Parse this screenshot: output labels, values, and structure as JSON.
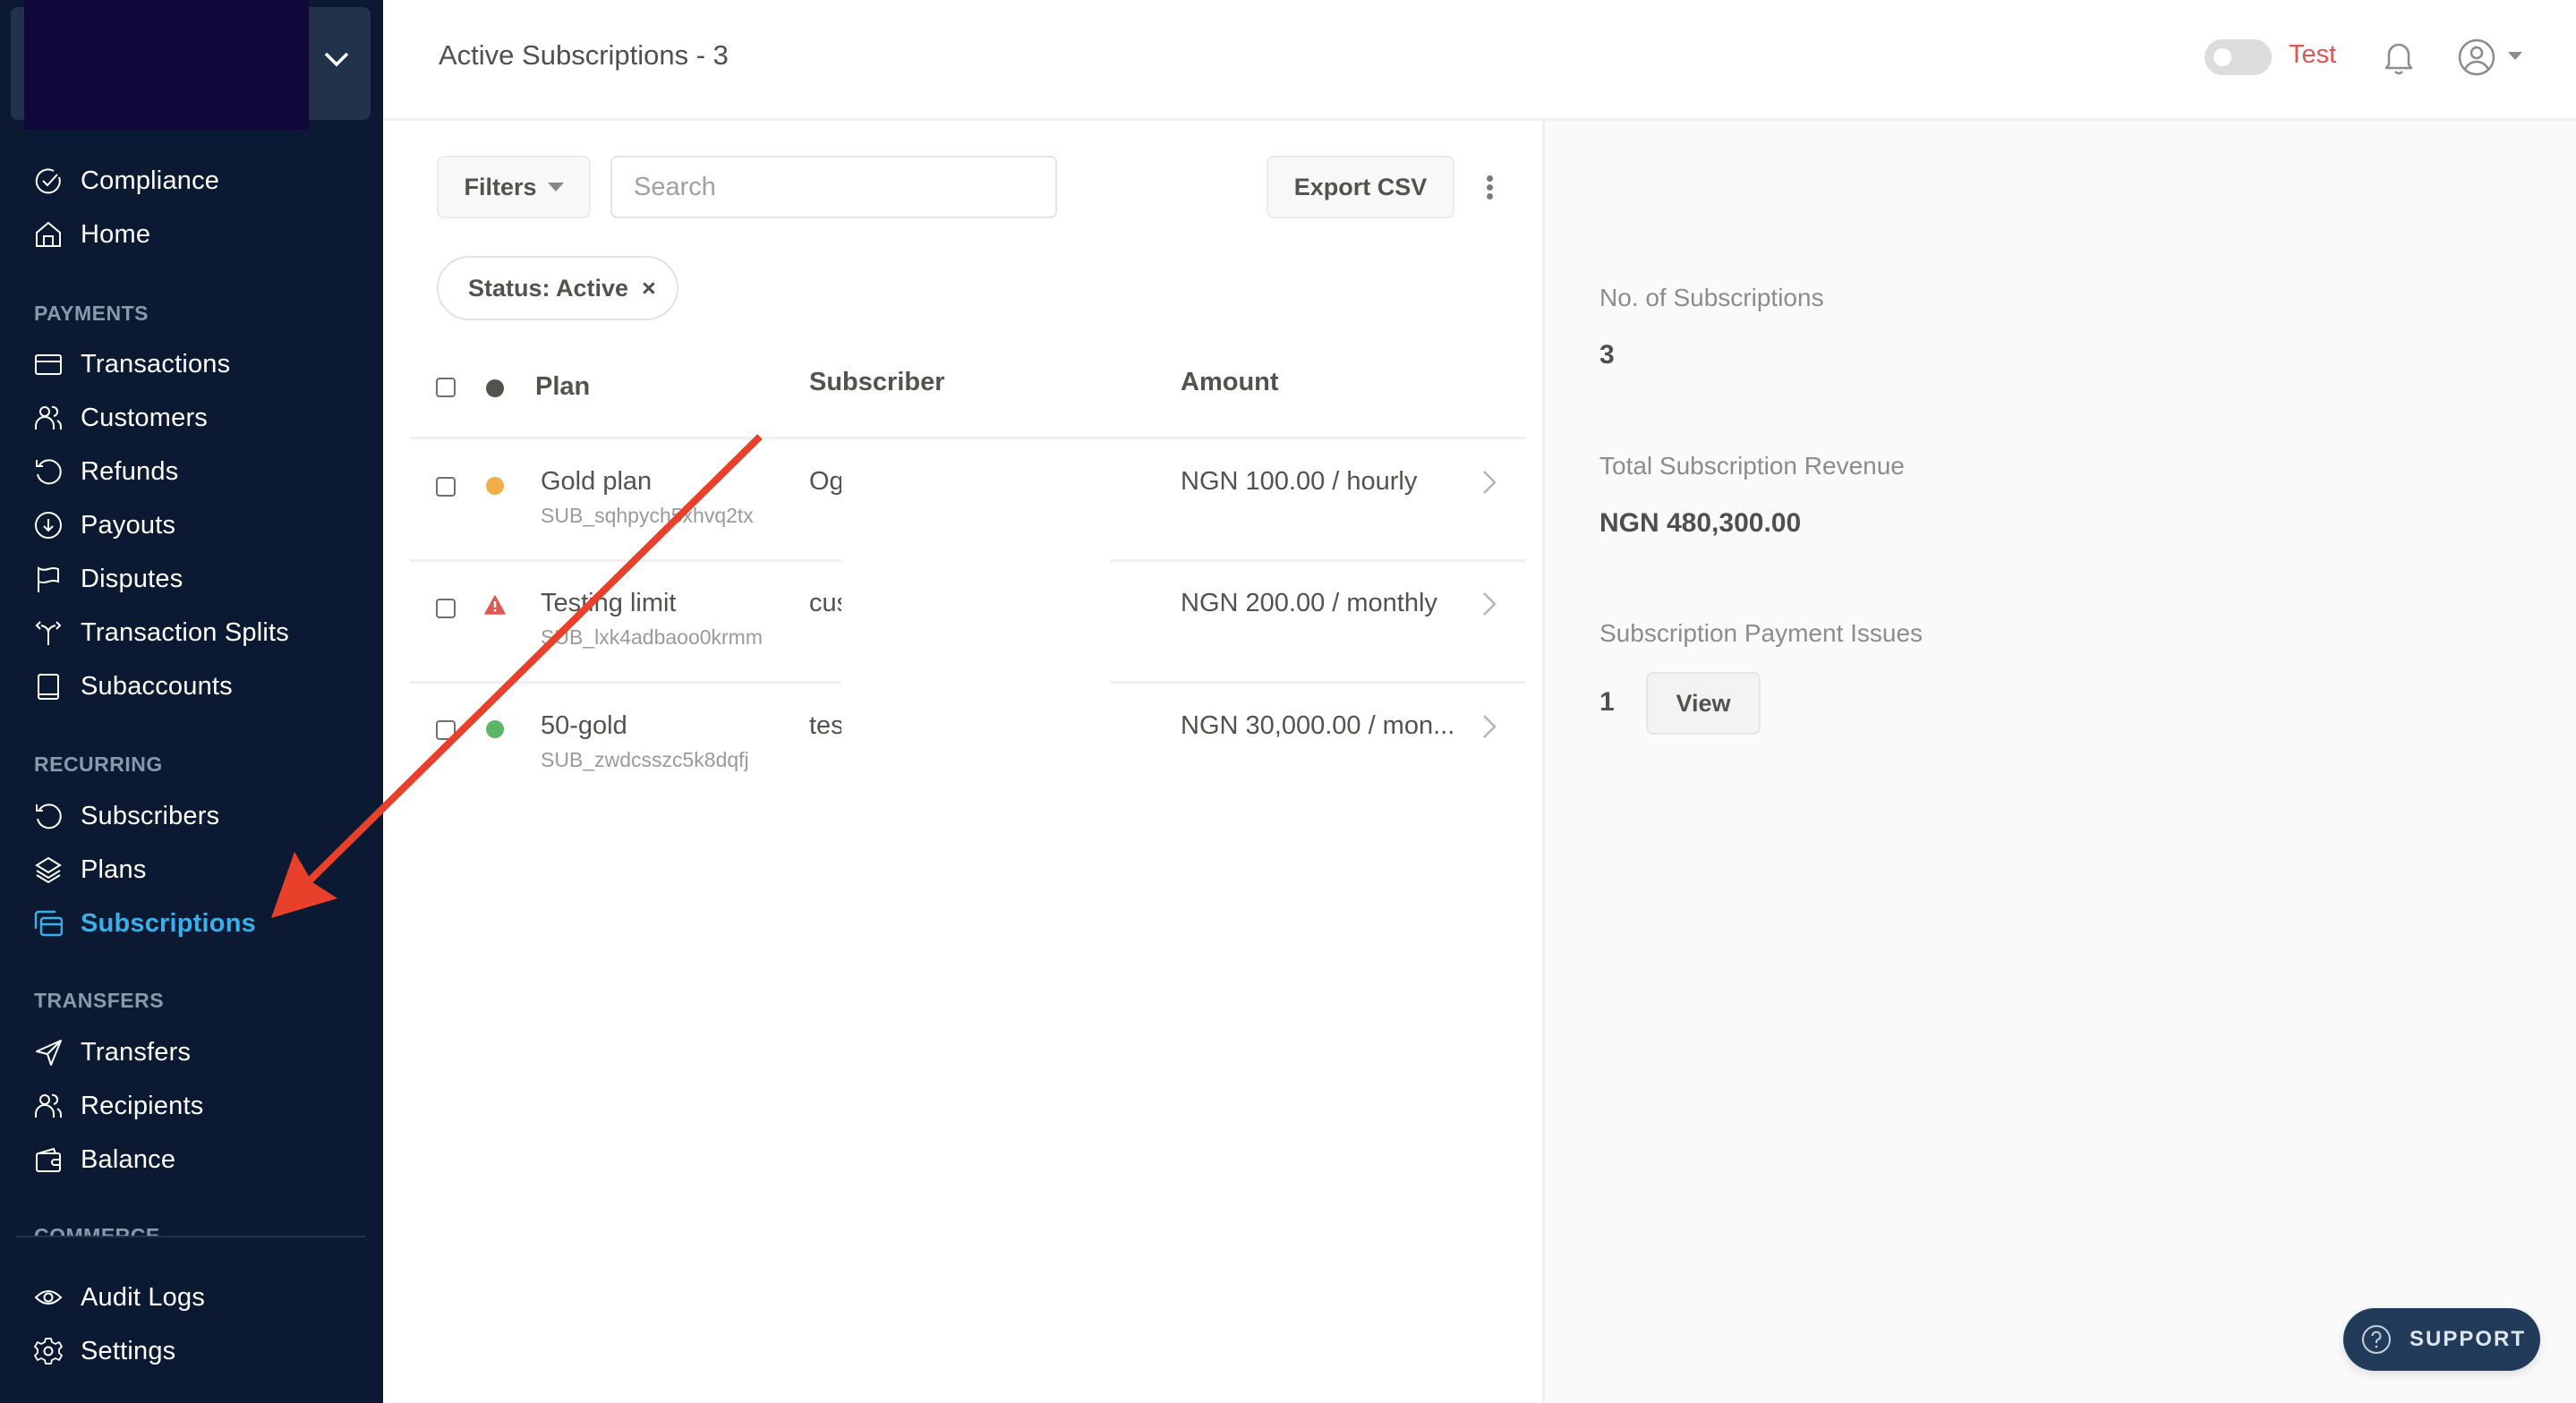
{
  "sidebar": {
    "top_items": [
      {
        "label": "Compliance",
        "icon": "check-circle-icon"
      },
      {
        "label": "Home",
        "icon": "home-icon"
      }
    ],
    "sections": [
      {
        "title": "PAYMENTS",
        "items": [
          {
            "label": "Transactions",
            "icon": "credit-card-icon"
          },
          {
            "label": "Customers",
            "icon": "users-icon"
          },
          {
            "label": "Refunds",
            "icon": "refresh-icon"
          },
          {
            "label": "Payouts",
            "icon": "arrow-down-circle-icon"
          },
          {
            "label": "Disputes",
            "icon": "flag-icon"
          },
          {
            "label": "Transaction Splits",
            "icon": "split-icon"
          },
          {
            "label": "Subaccounts",
            "icon": "book-icon"
          }
        ]
      },
      {
        "title": "RECURRING",
        "items": [
          {
            "label": "Subscribers",
            "icon": "refresh-icon"
          },
          {
            "label": "Plans",
            "icon": "layers-icon"
          },
          {
            "label": "Subscriptions",
            "icon": "cards-icon",
            "active": true
          }
        ]
      },
      {
        "title": "TRANSFERS",
        "items": [
          {
            "label": "Transfers",
            "icon": "send-icon"
          },
          {
            "label": "Recipients",
            "icon": "users-icon"
          },
          {
            "label": "Balance",
            "icon": "wallet-icon"
          }
        ]
      },
      {
        "title": "COMMERCE",
        "items": []
      }
    ],
    "bottom_items": [
      {
        "label": "Audit Logs",
        "icon": "eye-icon"
      },
      {
        "label": "Settings",
        "icon": "gear-icon"
      }
    ],
    "active_color": "#3bb0e8"
  },
  "header": {
    "title": "Active Subscriptions - 3",
    "mode_label": "Test",
    "mode_color": "#e0554e",
    "test_mode_on": false
  },
  "toolbar": {
    "filters_label": "Filters",
    "search_placeholder": "Search",
    "search_value": "",
    "export_label": "Export CSV",
    "active_filter": "Status: Active",
    "remove_filter": "×"
  },
  "table": {
    "columns": [
      "Plan",
      "Subscriber",
      "Amount"
    ],
    "rows": [
      {
        "status": "warning",
        "status_color": "#f2ad48",
        "plan": "Gold plan",
        "code": "SUB_sqhpych5xhvq2tx",
        "subscriber": "Og",
        "amount": "NGN 100.00 / hourly"
      },
      {
        "status": "issue",
        "status_color": "#e05a55",
        "plan": "Testing limit",
        "code": "SUB_lxk4adbaoo0krmm",
        "subscriber": "cus",
        "amount": "NGN 200.00 / monthly"
      },
      {
        "status": "active",
        "status_color": "#5cb567",
        "plan": "50-gold",
        "code": "SUB_zwdcsszc5k8dqfj",
        "subscriber": "tes",
        "amount": "NGN 30,000.00 / mon..."
      }
    ]
  },
  "stats": {
    "count_label": "No. of Subscriptions",
    "count_value": "3",
    "revenue_label": "Total Subscription Revenue",
    "revenue_value": "NGN 480,300.00",
    "issues_label": "Subscription Payment Issues",
    "issues_value": "1",
    "view_label": "View"
  },
  "support": {
    "label": "SUPPORT"
  },
  "annotation": {
    "color": "#e8402a",
    "points_to": "Subscriptions"
  }
}
